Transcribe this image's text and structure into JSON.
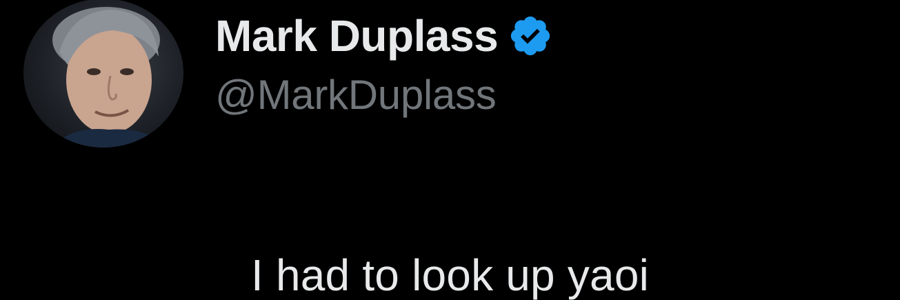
{
  "author": {
    "display_name": "Mark Duplass",
    "handle": "@MarkDuplass",
    "verified": true,
    "avatar_icon": "profile-photo",
    "verified_icon": "verified-badge-icon"
  },
  "tweet": {
    "text": "I had to look up yaoi"
  },
  "colors": {
    "background": "#000000",
    "name_text": "#e7e9ea",
    "handle_text": "#71767b",
    "verified_badge": "#1d9bf0"
  }
}
